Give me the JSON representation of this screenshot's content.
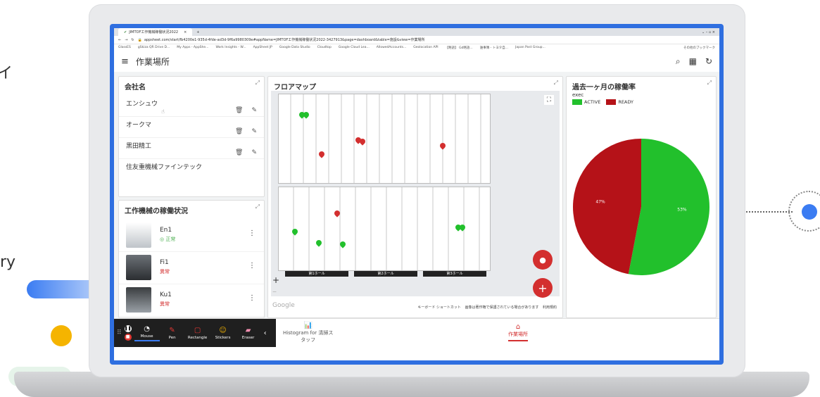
{
  "edge": {
    "left_top": "イ",
    "left_mid": "ry"
  },
  "browser": {
    "tab_title": "JIMTOF工作機械稼働状況2022",
    "address": "appsheet.com/start/fb4200e1-935d-4fde-ad3d-9f6a9980309e#appName=JIMTOF工作機械稼働状況2022-3427913&page=dashboard&table=施設&view=作業場所",
    "bookmarks": [
      "GlassES",
      "gSkiza QR Drive D...",
      "My Apps - AppShe...",
      "Work Insights - W...",
      "AppSheet JP",
      "Google Data Studio",
      "Cloudtop",
      "Google Cloud Lea...",
      "AllowedAccounts...",
      "Geolocation API",
      "【略語】 Gd略語...",
      "誰事簿 - トヨタ自...",
      "Japan Post Group...",
      "その他のブックマーク"
    ]
  },
  "app": {
    "title": "作業場所"
  },
  "companies": {
    "title": "会社名",
    "items": [
      {
        "name": "エンシュウ"
      },
      {
        "name": "オークマ"
      },
      {
        "name": "黒田精工"
      },
      {
        "name": "住友重機械ファインテック"
      }
    ]
  },
  "machines": {
    "title": "工作機械の稼働状況",
    "items": [
      {
        "name": "En1",
        "status": "◎ 正常",
        "status_color": "#4caf50"
      },
      {
        "name": "Fi1",
        "status": "異常",
        "status_color": "#d32f2f"
      },
      {
        "name": "Ku1",
        "status": "異常",
        "status_color": "#d32f2f"
      }
    ]
  },
  "floormap": {
    "title": "フロアマップ",
    "halls": [
      "第1ホール",
      "第2ホール",
      "第3ホール"
    ],
    "footer_shortcuts": "キーボード ショートカット",
    "footer_notice": "画像は著作権で保護されている場合があります",
    "footer_terms": "利用規約",
    "google": "Google"
  },
  "utilization": {
    "title": "過去一ヶ月の稼働率",
    "legend_title": "exec",
    "chart_data": {
      "type": "pie",
      "legend": "top-left",
      "series": [
        {
          "name": "ACTIVE",
          "value": 53,
          "label": "53%",
          "color": "#22c02c"
        },
        {
          "name": "READY",
          "value": 47,
          "label": "47%",
          "color": "#b51218"
        }
      ]
    }
  },
  "annotation_toolbar": {
    "tools": [
      {
        "label": "Mouse",
        "icon": "cursor-icon"
      },
      {
        "label": "Pen",
        "icon": "pen-icon"
      },
      {
        "label": "Rectangle",
        "icon": "rectangle-icon"
      },
      {
        "label": "Stickers",
        "icon": "sticker-icon"
      },
      {
        "label": "Eraser",
        "icon": "eraser-icon"
      }
    ]
  },
  "bottom_nav": {
    "items": [
      {
        "label": "Histogram for 清掃ス",
        "label2": "タッフ"
      },
      {
        "label": "作業場所"
      }
    ],
    "active_color": "#d32f2f"
  }
}
